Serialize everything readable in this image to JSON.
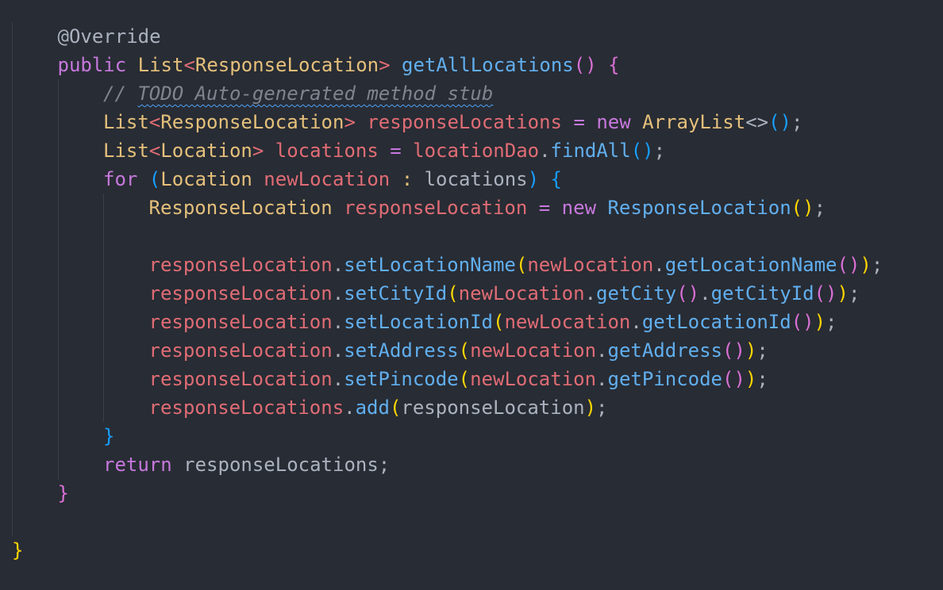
{
  "colors": {
    "background": "#282c34",
    "annotation": "#abb2bf",
    "keyword": "#c678dd",
    "type": "#e5c07b",
    "method": "#61afef",
    "variable": "#e06c75",
    "plain": "#abb2bf",
    "comment": "#7f848e",
    "bracket_yellow": "#ffd700",
    "bracket_purple": "#da70d6",
    "bracket_blue": "#179fff",
    "indent_guide": "#3b4048",
    "squiggle": "#4fa3f7"
  },
  "code_lines": [
    {
      "indent": 1,
      "tokens": [
        {
          "text": "@Override",
          "kind": "annotation"
        }
      ]
    },
    {
      "indent": 1,
      "tokens": [
        {
          "text": "public ",
          "kind": "keyword"
        },
        {
          "text": "List",
          "kind": "type"
        },
        {
          "text": "<",
          "kind": "variable"
        },
        {
          "text": "ResponseLocation",
          "kind": "type"
        },
        {
          "text": ">",
          "kind": "variable"
        },
        {
          "text": " ",
          "kind": "plain"
        },
        {
          "text": "getAllLocations",
          "kind": "method"
        },
        {
          "text": "()",
          "kind": "bracket_purple"
        },
        {
          "text": " ",
          "kind": "plain"
        },
        {
          "text": "{",
          "kind": "bracket_purple"
        }
      ]
    },
    {
      "indent": 2,
      "tokens": [
        {
          "text": "// ",
          "kind": "comment",
          "italic": true
        },
        {
          "text": "TODO Auto-generated method stub",
          "kind": "comment",
          "italic": true,
          "squiggle": true
        }
      ]
    },
    {
      "indent": 2,
      "tokens": [
        {
          "text": "List",
          "kind": "type"
        },
        {
          "text": "<",
          "kind": "variable"
        },
        {
          "text": "ResponseLocation",
          "kind": "type"
        },
        {
          "text": ">",
          "kind": "variable"
        },
        {
          "text": " responseLocations ",
          "kind": "variable"
        },
        {
          "text": "=",
          "kind": "keyword"
        },
        {
          "text": " new ",
          "kind": "keyword"
        },
        {
          "text": "ArrayList",
          "kind": "type"
        },
        {
          "text": "<>",
          "kind": "plain"
        },
        {
          "text": "()",
          "kind": "bracket_blue"
        },
        {
          "text": ";",
          "kind": "plain"
        }
      ]
    },
    {
      "indent": 2,
      "tokens": [
        {
          "text": "List",
          "kind": "type"
        },
        {
          "text": "<",
          "kind": "variable"
        },
        {
          "text": "Location",
          "kind": "type"
        },
        {
          "text": ">",
          "kind": "variable"
        },
        {
          "text": " locations ",
          "kind": "variable"
        },
        {
          "text": "=",
          "kind": "keyword"
        },
        {
          "text": " locationDao",
          "kind": "variable"
        },
        {
          "text": ".",
          "kind": "plain"
        },
        {
          "text": "findAll",
          "kind": "method"
        },
        {
          "text": "()",
          "kind": "bracket_blue"
        },
        {
          "text": ";",
          "kind": "plain"
        }
      ]
    },
    {
      "indent": 2,
      "tokens": [
        {
          "text": "for ",
          "kind": "keyword"
        },
        {
          "text": "(",
          "kind": "bracket_blue"
        },
        {
          "text": "Location",
          "kind": "type"
        },
        {
          "text": " newLocation ",
          "kind": "variable"
        },
        {
          "text": ":",
          "kind": "type"
        },
        {
          "text": " locations",
          "kind": "plain"
        },
        {
          "text": ")",
          "kind": "bracket_blue"
        },
        {
          "text": " ",
          "kind": "plain"
        },
        {
          "text": "{",
          "kind": "bracket_blue"
        }
      ]
    },
    {
      "indent": 3,
      "tokens": [
        {
          "text": "ResponseLocation",
          "kind": "type"
        },
        {
          "text": " responseLocation ",
          "kind": "variable"
        },
        {
          "text": "=",
          "kind": "keyword"
        },
        {
          "text": " new ",
          "kind": "keyword"
        },
        {
          "text": "ResponseLocation",
          "kind": "method"
        },
        {
          "text": "()",
          "kind": "bracket_yellow"
        },
        {
          "text": ";",
          "kind": "plain"
        }
      ]
    },
    {
      "indent": 3,
      "tokens": []
    },
    {
      "indent": 3,
      "tokens": [
        {
          "text": "responseLocation",
          "kind": "variable"
        },
        {
          "text": ".",
          "kind": "plain"
        },
        {
          "text": "setLocationName",
          "kind": "method"
        },
        {
          "text": "(",
          "kind": "bracket_yellow"
        },
        {
          "text": "newLocation",
          "kind": "variable"
        },
        {
          "text": ".",
          "kind": "plain"
        },
        {
          "text": "getLocationName",
          "kind": "method"
        },
        {
          "text": "()",
          "kind": "bracket_purple"
        },
        {
          "text": ")",
          "kind": "bracket_yellow"
        },
        {
          "text": ";",
          "kind": "plain"
        }
      ]
    },
    {
      "indent": 3,
      "tokens": [
        {
          "text": "responseLocation",
          "kind": "variable"
        },
        {
          "text": ".",
          "kind": "plain"
        },
        {
          "text": "setCityId",
          "kind": "method"
        },
        {
          "text": "(",
          "kind": "bracket_yellow"
        },
        {
          "text": "newLocation",
          "kind": "variable"
        },
        {
          "text": ".",
          "kind": "plain"
        },
        {
          "text": "getCity",
          "kind": "method"
        },
        {
          "text": "()",
          "kind": "bracket_purple"
        },
        {
          "text": ".",
          "kind": "plain"
        },
        {
          "text": "getCityId",
          "kind": "method"
        },
        {
          "text": "()",
          "kind": "bracket_purple"
        },
        {
          "text": ")",
          "kind": "bracket_yellow"
        },
        {
          "text": ";",
          "kind": "plain"
        }
      ]
    },
    {
      "indent": 3,
      "tokens": [
        {
          "text": "responseLocation",
          "kind": "variable"
        },
        {
          "text": ".",
          "kind": "plain"
        },
        {
          "text": "setLocationId",
          "kind": "method"
        },
        {
          "text": "(",
          "kind": "bracket_yellow"
        },
        {
          "text": "newLocation",
          "kind": "variable"
        },
        {
          "text": ".",
          "kind": "plain"
        },
        {
          "text": "getLocationId",
          "kind": "method"
        },
        {
          "text": "()",
          "kind": "bracket_purple"
        },
        {
          "text": ")",
          "kind": "bracket_yellow"
        },
        {
          "text": ";",
          "kind": "plain"
        }
      ]
    },
    {
      "indent": 3,
      "tokens": [
        {
          "text": "responseLocation",
          "kind": "variable"
        },
        {
          "text": ".",
          "kind": "plain"
        },
        {
          "text": "setAddress",
          "kind": "method"
        },
        {
          "text": "(",
          "kind": "bracket_yellow"
        },
        {
          "text": "newLocation",
          "kind": "variable"
        },
        {
          "text": ".",
          "kind": "plain"
        },
        {
          "text": "getAddress",
          "kind": "method"
        },
        {
          "text": "()",
          "kind": "bracket_purple"
        },
        {
          "text": ")",
          "kind": "bracket_yellow"
        },
        {
          "text": ";",
          "kind": "plain"
        }
      ]
    },
    {
      "indent": 3,
      "tokens": [
        {
          "text": "responseLocation",
          "kind": "variable"
        },
        {
          "text": ".",
          "kind": "plain"
        },
        {
          "text": "setPincode",
          "kind": "method"
        },
        {
          "text": "(",
          "kind": "bracket_yellow"
        },
        {
          "text": "newLocation",
          "kind": "variable"
        },
        {
          "text": ".",
          "kind": "plain"
        },
        {
          "text": "getPincode",
          "kind": "method"
        },
        {
          "text": "()",
          "kind": "bracket_purple"
        },
        {
          "text": ")",
          "kind": "bracket_yellow"
        },
        {
          "text": ";",
          "kind": "plain"
        }
      ]
    },
    {
      "indent": 3,
      "tokens": [
        {
          "text": "responseLocations",
          "kind": "variable"
        },
        {
          "text": ".",
          "kind": "plain"
        },
        {
          "text": "add",
          "kind": "method"
        },
        {
          "text": "(",
          "kind": "bracket_yellow"
        },
        {
          "text": "responseLocation",
          "kind": "plain"
        },
        {
          "text": ")",
          "kind": "bracket_yellow"
        },
        {
          "text": ";",
          "kind": "plain"
        }
      ]
    },
    {
      "indent": 2,
      "tokens": [
        {
          "text": "}",
          "kind": "bracket_blue"
        }
      ]
    },
    {
      "indent": 2,
      "tokens": [
        {
          "text": "return ",
          "kind": "keyword"
        },
        {
          "text": "responseLocations",
          "kind": "plain"
        },
        {
          "text": ";",
          "kind": "plain"
        }
      ]
    },
    {
      "indent": 1,
      "tokens": [
        {
          "text": "}",
          "kind": "bracket_purple"
        }
      ]
    },
    {
      "indent": 0,
      "tokens": []
    },
    {
      "indent": 0,
      "tokens": [
        {
          "text": "}",
          "kind": "bracket_yellow"
        }
      ]
    }
  ]
}
